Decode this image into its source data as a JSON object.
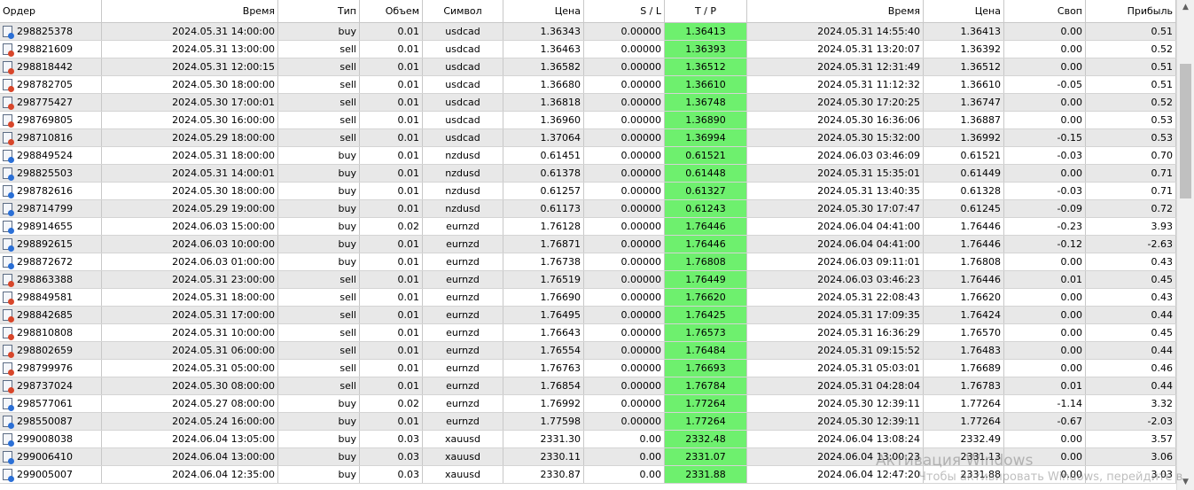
{
  "columns": [
    "Ордер",
    "Время",
    "Тип",
    "Объем",
    "Символ",
    "Цена",
    "S / L",
    "T / P",
    "Время",
    "Цена",
    "Своп",
    "Прибыль"
  ],
  "rows": [
    [
      "298825378",
      "2024.05.31 14:00:00",
      "buy",
      "0.01",
      "usdcad",
      "1.36343",
      "0.00000",
      "1.36413",
      "2024.05.31 14:55:40",
      "1.36413",
      "0.00",
      "0.51"
    ],
    [
      "298821609",
      "2024.05.31 13:00:00",
      "sell",
      "0.01",
      "usdcad",
      "1.36463",
      "0.00000",
      "1.36393",
      "2024.05.31 13:20:07",
      "1.36392",
      "0.00",
      "0.52"
    ],
    [
      "298818442",
      "2024.05.31 12:00:15",
      "sell",
      "0.01",
      "usdcad",
      "1.36582",
      "0.00000",
      "1.36512",
      "2024.05.31 12:31:49",
      "1.36512",
      "0.00",
      "0.51"
    ],
    [
      "298782705",
      "2024.05.30 18:00:00",
      "sell",
      "0.01",
      "usdcad",
      "1.36680",
      "0.00000",
      "1.36610",
      "2024.05.31 11:12:32",
      "1.36610",
      "-0.05",
      "0.51"
    ],
    [
      "298775427",
      "2024.05.30 17:00:01",
      "sell",
      "0.01",
      "usdcad",
      "1.36818",
      "0.00000",
      "1.36748",
      "2024.05.30 17:20:25",
      "1.36747",
      "0.00",
      "0.52"
    ],
    [
      "298769805",
      "2024.05.30 16:00:00",
      "sell",
      "0.01",
      "usdcad",
      "1.36960",
      "0.00000",
      "1.36890",
      "2024.05.30 16:36:06",
      "1.36887",
      "0.00",
      "0.53"
    ],
    [
      "298710816",
      "2024.05.29 18:00:00",
      "sell",
      "0.01",
      "usdcad",
      "1.37064",
      "0.00000",
      "1.36994",
      "2024.05.30 15:32:00",
      "1.36992",
      "-0.15",
      "0.53"
    ],
    [
      "298849524",
      "2024.05.31 18:00:00",
      "buy",
      "0.01",
      "nzdusd",
      "0.61451",
      "0.00000",
      "0.61521",
      "2024.06.03 03:46:09",
      "0.61521",
      "-0.03",
      "0.70"
    ],
    [
      "298825503",
      "2024.05.31 14:00:01",
      "buy",
      "0.01",
      "nzdusd",
      "0.61378",
      "0.00000",
      "0.61448",
      "2024.05.31 15:35:01",
      "0.61449",
      "0.00",
      "0.71"
    ],
    [
      "298782616",
      "2024.05.30 18:00:00",
      "buy",
      "0.01",
      "nzdusd",
      "0.61257",
      "0.00000",
      "0.61327",
      "2024.05.31 13:40:35",
      "0.61328",
      "-0.03",
      "0.71"
    ],
    [
      "298714799",
      "2024.05.29 19:00:00",
      "buy",
      "0.01",
      "nzdusd",
      "0.61173",
      "0.00000",
      "0.61243",
      "2024.05.30 17:07:47",
      "0.61245",
      "-0.09",
      "0.72"
    ],
    [
      "298914655",
      "2024.06.03 15:00:00",
      "buy",
      "0.02",
      "eurnzd",
      "1.76128",
      "0.00000",
      "1.76446",
      "2024.06.04 04:41:00",
      "1.76446",
      "-0.23",
      "3.93"
    ],
    [
      "298892615",
      "2024.06.03 10:00:00",
      "buy",
      "0.01",
      "eurnzd",
      "1.76871",
      "0.00000",
      "1.76446",
      "2024.06.04 04:41:00",
      "1.76446",
      "-0.12",
      "-2.63"
    ],
    [
      "298872672",
      "2024.06.03 01:00:00",
      "buy",
      "0.01",
      "eurnzd",
      "1.76738",
      "0.00000",
      "1.76808",
      "2024.06.03 09:11:01",
      "1.76808",
      "0.00",
      "0.43"
    ],
    [
      "298863388",
      "2024.05.31 23:00:00",
      "sell",
      "0.01",
      "eurnzd",
      "1.76519",
      "0.00000",
      "1.76449",
      "2024.06.03 03:46:23",
      "1.76446",
      "0.01",
      "0.45"
    ],
    [
      "298849581",
      "2024.05.31 18:00:00",
      "sell",
      "0.01",
      "eurnzd",
      "1.76690",
      "0.00000",
      "1.76620",
      "2024.05.31 22:08:43",
      "1.76620",
      "0.00",
      "0.43"
    ],
    [
      "298842685",
      "2024.05.31 17:00:00",
      "sell",
      "0.01",
      "eurnzd",
      "1.76495",
      "0.00000",
      "1.76425",
      "2024.05.31 17:09:35",
      "1.76424",
      "0.00",
      "0.44"
    ],
    [
      "298810808",
      "2024.05.31 10:00:00",
      "sell",
      "0.01",
      "eurnzd",
      "1.76643",
      "0.00000",
      "1.76573",
      "2024.05.31 16:36:29",
      "1.76570",
      "0.00",
      "0.45"
    ],
    [
      "298802659",
      "2024.05.31 06:00:00",
      "sell",
      "0.01",
      "eurnzd",
      "1.76554",
      "0.00000",
      "1.76484",
      "2024.05.31 09:15:52",
      "1.76483",
      "0.00",
      "0.44"
    ],
    [
      "298799976",
      "2024.05.31 05:00:00",
      "sell",
      "0.01",
      "eurnzd",
      "1.76763",
      "0.00000",
      "1.76693",
      "2024.05.31 05:03:01",
      "1.76689",
      "0.00",
      "0.46"
    ],
    [
      "298737024",
      "2024.05.30 08:00:00",
      "sell",
      "0.01",
      "eurnzd",
      "1.76854",
      "0.00000",
      "1.76784",
      "2024.05.31 04:28:04",
      "1.76783",
      "0.01",
      "0.44"
    ],
    [
      "298577061",
      "2024.05.27 08:00:00",
      "buy",
      "0.02",
      "eurnzd",
      "1.76992",
      "0.00000",
      "1.77264",
      "2024.05.30 12:39:11",
      "1.77264",
      "-1.14",
      "3.32"
    ],
    [
      "298550087",
      "2024.05.24 16:00:00",
      "buy",
      "0.01",
      "eurnzd",
      "1.77598",
      "0.00000",
      "1.77264",
      "2024.05.30 12:39:11",
      "1.77264",
      "-0.67",
      "-2.03"
    ],
    [
      "299008038",
      "2024.06.04 13:05:00",
      "buy",
      "0.03",
      "xauusd",
      "2331.30",
      "0.00",
      "2332.48",
      "2024.06.04 13:08:24",
      "2332.49",
      "0.00",
      "3.57"
    ],
    [
      "299006410",
      "2024.06.04 13:00:00",
      "buy",
      "0.03",
      "xauusd",
      "2330.11",
      "0.00",
      "2331.07",
      "2024.06.04 13:00:23",
      "2331.13",
      "0.00",
      "3.06"
    ],
    [
      "299005007",
      "2024.06.04 12:35:00",
      "buy",
      "0.03",
      "xauusd",
      "2330.87",
      "0.00",
      "2331.88",
      "2024.06.04 12:47:20",
      "2331.88",
      "0.00",
      "3.03"
    ]
  ],
  "watermark": {
    "title": "Активация Windows",
    "subtitle": "Чтобы активировать Windows, перейдите в"
  },
  "colors": {
    "tp_highlight": "#6ef06e",
    "row_alt": "#e8e8e8",
    "buy_marker": "#2a6fd6",
    "sell_marker": "#d8462a"
  },
  "icons": {
    "order": "order-document-icon",
    "scroll_up": "arrow-up-icon",
    "scroll_down": "arrow-down-icon"
  }
}
